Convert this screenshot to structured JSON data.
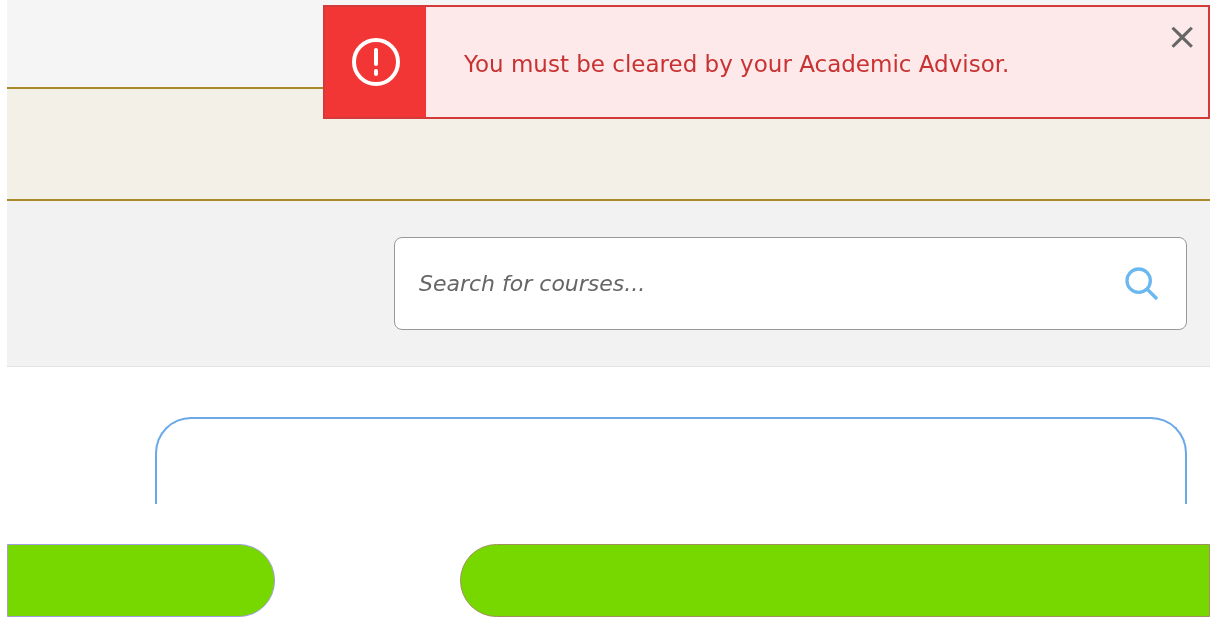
{
  "alert": {
    "message": "You must be cleared by your Academic Advisor.",
    "close": "×"
  },
  "search": {
    "placeholder": "Search for courses..."
  }
}
